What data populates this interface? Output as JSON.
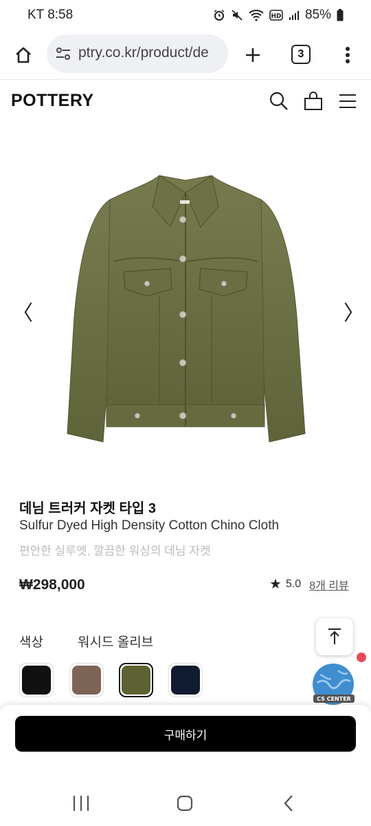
{
  "status_bar": {
    "carrier_time": "KT 8:58",
    "battery": "85%"
  },
  "browser": {
    "url": "ptry.co.kr/product/de",
    "tab_count": "3"
  },
  "site": {
    "logo": "POTTERY"
  },
  "carousel": {
    "prev": "〈",
    "next": "〉"
  },
  "product": {
    "name_ko": "데님 트러커 자켓 타입 3",
    "name_en": "Sulfur Dyed High Density Cotton Chino Cloth",
    "description": "편안한 실루엣, 깔끔한 워싱의 데님 자켓",
    "price": "₩298,000",
    "rating": "5.0",
    "review_count": "8개 리뷰",
    "image_alt_color": "#6e7146"
  },
  "options": {
    "color_label": "색상",
    "selected_color_name": "워시드 올리브",
    "swatches": [
      {
        "color": "#111111"
      },
      {
        "color": "#7d6455"
      },
      {
        "color": "#5e6131",
        "selected": true
      },
      {
        "color": "#101a30"
      }
    ]
  },
  "floating": {
    "cs_label": "CS CENTER"
  },
  "purchase": {
    "buy_label": "구매하기"
  }
}
